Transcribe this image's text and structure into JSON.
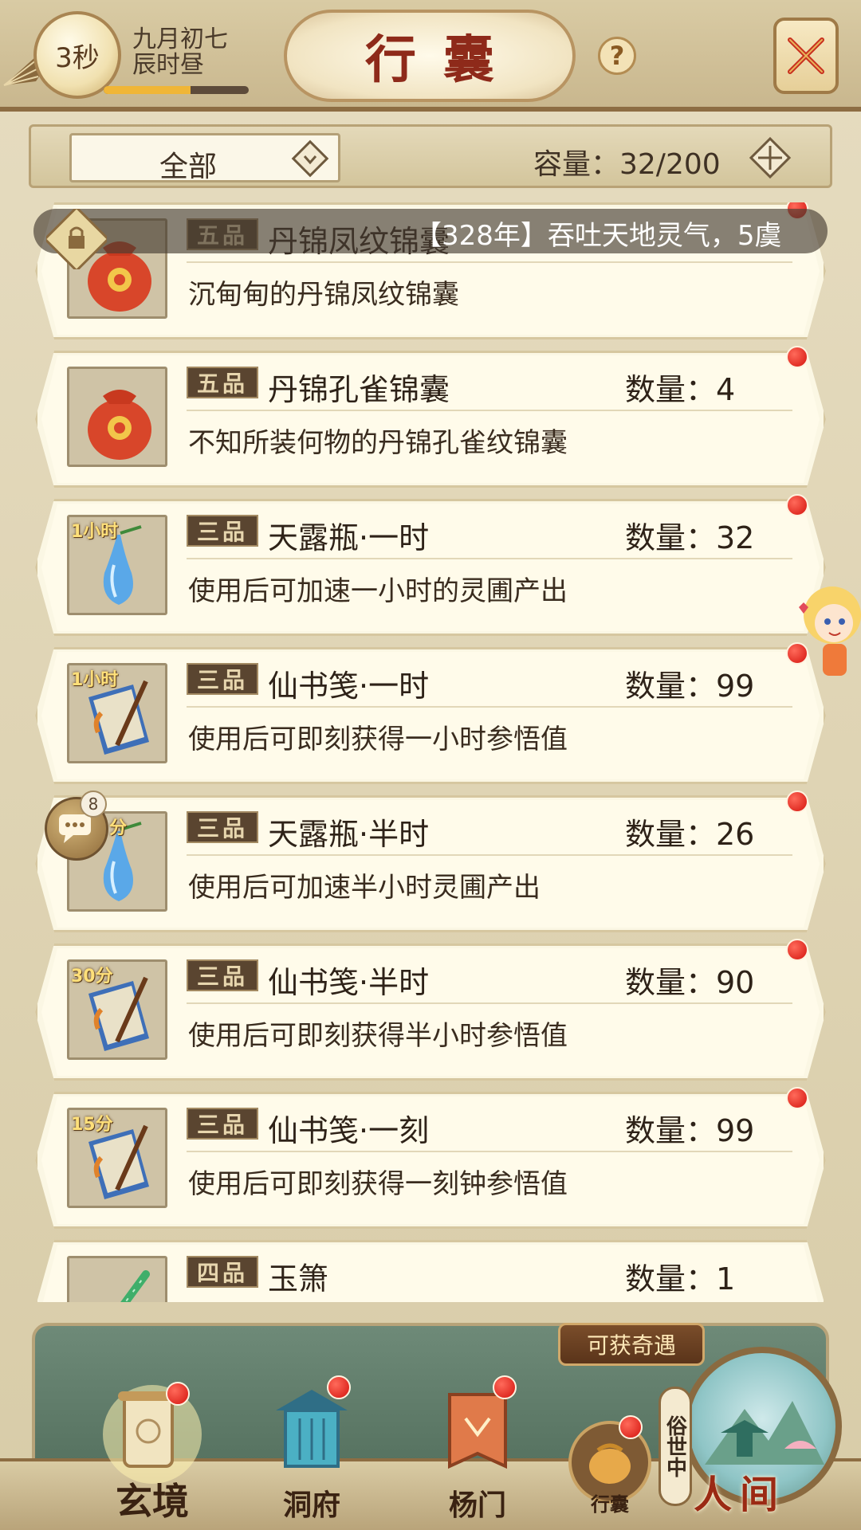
{
  "header": {
    "timer": "3秒",
    "date_line1": "九月初七",
    "date_line2": "辰时昼",
    "time_progress": 0.6,
    "title": "行囊",
    "help": "?"
  },
  "filter": {
    "selected": "全部",
    "capacity": "容量：32/200"
  },
  "notice": {
    "text": "【328年】吞吐天地灵气，5虞"
  },
  "items": [
    {
      "grade": "五品",
      "name": "丹锦凤纹锦囊",
      "qty_label": "",
      "desc": "沉甸甸的丹锦凤纹锦囊",
      "time_tag": "",
      "icon": "brocade-pouch-icon"
    },
    {
      "grade": "五品",
      "name": "丹锦孔雀锦囊",
      "qty_label": "数量：4",
      "desc": "不知所装何物的丹锦孔雀纹锦囊",
      "time_tag": "",
      "icon": "brocade-pouch-icon"
    },
    {
      "grade": "三品",
      "name": "天露瓶·一时",
      "qty_label": "数量：32",
      "desc": "使用后可加速一小时的灵圃产出",
      "time_tag": "1小时",
      "icon": "dew-vase-icon"
    },
    {
      "grade": "三品",
      "name": "仙书笺·一时",
      "qty_label": "数量：99",
      "desc": "使用后可即刻获得一小时参悟值",
      "time_tag": "1小时",
      "icon": "scroll-book-icon"
    },
    {
      "grade": "三品",
      "name": "天露瓶·半时",
      "qty_label": "数量：26",
      "desc": "使用后可加速半小时灵圃产出",
      "time_tag": "分",
      "icon": "dew-vase-icon"
    },
    {
      "grade": "三品",
      "name": "仙书笺·半时",
      "qty_label": "数量：90",
      "desc": "使用后可即刻获得半小时参悟值",
      "time_tag": "30分",
      "icon": "scroll-book-icon"
    },
    {
      "grade": "三品",
      "name": "仙书笺·一刻",
      "qty_label": "数量：99",
      "desc": "使用后可即刻获得一刻钟参悟值",
      "time_tag": "15分",
      "icon": "scroll-book-icon"
    },
    {
      "grade": "四品",
      "name": "玉箫",
      "qty_label": "数量：1",
      "desc": "",
      "time_tag": "",
      "icon": "jade-flute-icon"
    }
  ],
  "chat": {
    "count": "8"
  },
  "bottom_nav": {
    "encounter": "可获奇遇",
    "items": [
      {
        "label": "玄境",
        "icon": "scroll-icon"
      },
      {
        "label": "洞府",
        "icon": "lantern-pavilion-icon"
      },
      {
        "label": "杨门",
        "icon": "banner-icon"
      },
      {
        "label": "行囊",
        "icon": "bag-icon"
      }
    ],
    "world_status": "俗世中",
    "world_label": "人间"
  },
  "colors": {
    "title_red": "#8e2a1a",
    "badge_dark": "#5a4530",
    "notification_red": "#d4140e",
    "panel_green": "#5e7a68"
  }
}
